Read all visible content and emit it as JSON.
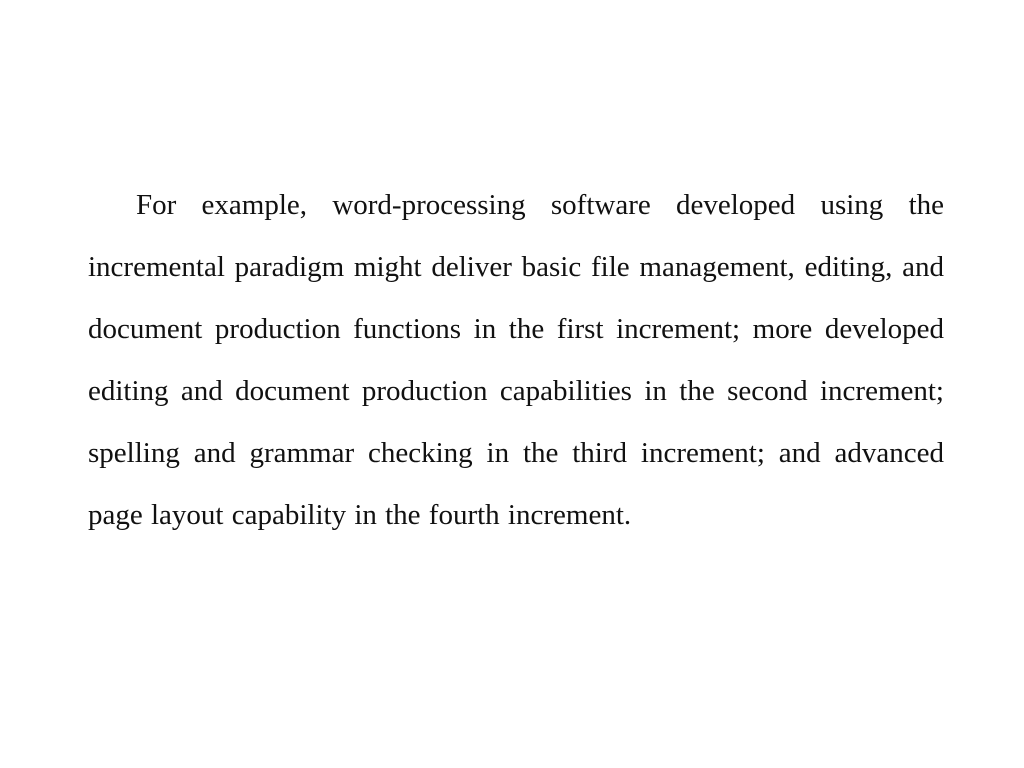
{
  "slide": {
    "paragraph": "For example, word-processing software developed using the incremental paradigm might deliver basic file management, editing, and document production functions in the first increment; more developed editing and document production capabilities in the second increment; spelling and grammar checking in the third increment; and advanced page layout capability in the fourth increment."
  }
}
